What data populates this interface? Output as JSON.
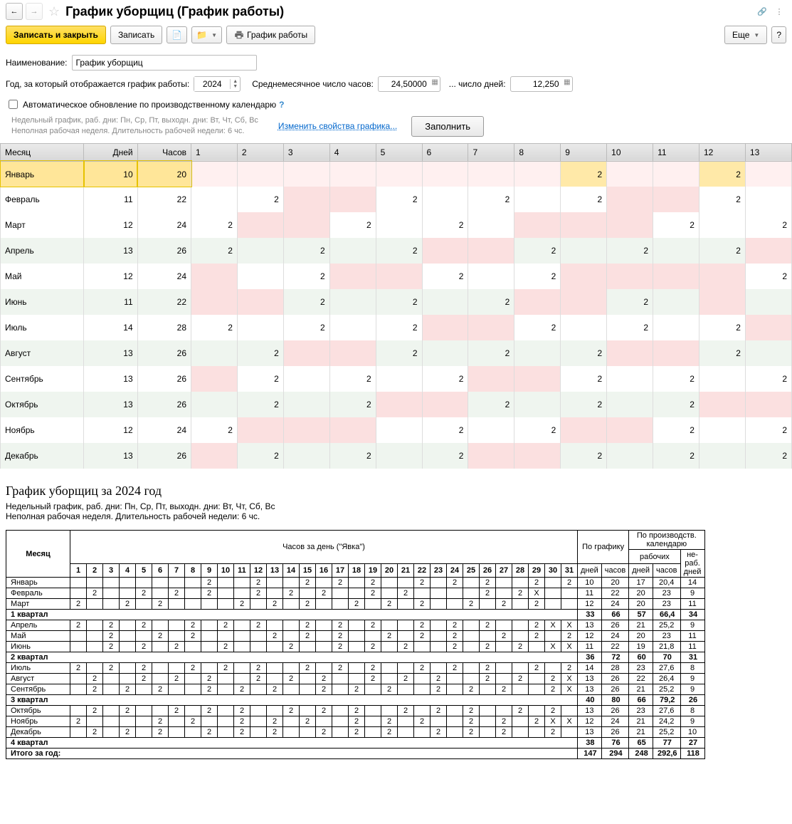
{
  "header": {
    "title": "График уборщиц (График работы)"
  },
  "toolbar": {
    "save_close": "Записать и закрыть",
    "save": "Записать",
    "print_schedule": "График работы",
    "more": "Еще"
  },
  "form": {
    "name_label": "Наименование:",
    "name_value": "График уборщиц",
    "year_label": "Год, за который отображается график работы:",
    "year_value": "2024",
    "avg_hours_label": "Среднемесячное число часов:",
    "avg_hours_value": "24,50000",
    "avg_days_label": "... число дней:",
    "avg_days_value": "12,250",
    "auto_update_label": "Автоматическое обновление по производственному календарю",
    "hint_line1": "Недельный график, раб. дни: Пн, Ср, Пт, выходн. дни: Вт, Чт, Сб, Вс",
    "hint_line2": "Неполная рабочая неделя. Длительность рабочей недели: 6 чс.",
    "change_props_link": "Изменить свойства графика...",
    "fill_btn": "Заполнить"
  },
  "cal_headers": {
    "month": "Месяц",
    "days": "Дней",
    "hours": "Часов"
  },
  "cal_day_cols": [
    "1",
    "2",
    "3",
    "4",
    "5",
    "6",
    "7",
    "8",
    "9",
    "10",
    "11",
    "12",
    "13"
  ],
  "cal_rows": [
    {
      "month": "Январь",
      "days": "10",
      "hours": "20",
      "selected": true,
      "cells": [
        {},
        {},
        {},
        {},
        {},
        {},
        {},
        {},
        {
          "v": "2",
          "h": true
        },
        {},
        {},
        {
          "v": "2",
          "h": true
        },
        {}
      ]
    },
    {
      "month": "Февраль",
      "days": "11",
      "hours": "22",
      "cells": [
        {},
        {
          "v": "2"
        },
        {
          "w": true
        },
        {
          "w": true
        },
        {
          "v": "2"
        },
        {},
        {
          "v": "2"
        },
        {},
        {
          "v": "2"
        },
        {
          "w": true
        },
        {
          "w": true
        },
        {
          "v": "2"
        },
        {}
      ]
    },
    {
      "month": "Март",
      "days": "12",
      "hours": "24",
      "cells": [
        {
          "v": "2"
        },
        {
          "w": true
        },
        {
          "w": true
        },
        {
          "v": "2"
        },
        {},
        {
          "v": "2"
        },
        {},
        {
          "w": true
        },
        {
          "w": true
        },
        {
          "w": true
        },
        {
          "v": "2"
        },
        {},
        {
          "v": "2"
        }
      ]
    },
    {
      "month": "Апрель",
      "days": "13",
      "hours": "26",
      "even": true,
      "cells": [
        {
          "v": "2"
        },
        {},
        {
          "v": "2"
        },
        {},
        {
          "v": "2"
        },
        {
          "w": true
        },
        {
          "w": true
        },
        {
          "v": "2"
        },
        {},
        {
          "v": "2"
        },
        {},
        {
          "v": "2"
        },
        {
          "w": true
        }
      ]
    },
    {
      "month": "Май",
      "days": "12",
      "hours": "24",
      "cells": [
        {
          "w": true
        },
        {},
        {
          "v": "2"
        },
        {
          "w": true
        },
        {
          "w": true
        },
        {
          "v": "2"
        },
        {},
        {
          "v": "2"
        },
        {
          "w": true
        },
        {
          "w": true
        },
        {
          "w": true
        },
        {
          "w": true
        },
        {
          "v": "2"
        }
      ]
    },
    {
      "month": "Июнь",
      "days": "11",
      "hours": "22",
      "even": true,
      "cells": [
        {
          "w": true
        },
        {
          "w": true
        },
        {
          "v": "2"
        },
        {},
        {
          "v": "2"
        },
        {},
        {
          "v": "2"
        },
        {
          "w": true
        },
        {
          "w": true
        },
        {
          "v": "2"
        },
        {},
        {
          "w": true
        },
        {}
      ]
    },
    {
      "month": "Июль",
      "days": "14",
      "hours": "28",
      "cells": [
        {
          "v": "2"
        },
        {},
        {
          "v": "2"
        },
        {},
        {
          "v": "2"
        },
        {
          "w": true
        },
        {
          "w": true
        },
        {
          "v": "2"
        },
        {},
        {
          "v": "2"
        },
        {},
        {
          "v": "2"
        },
        {
          "w": true
        }
      ]
    },
    {
      "month": "Август",
      "days": "13",
      "hours": "26",
      "even": true,
      "cells": [
        {},
        {
          "v": "2"
        },
        {
          "w": true
        },
        {
          "w": true
        },
        {
          "v": "2"
        },
        {},
        {
          "v": "2"
        },
        {},
        {
          "v": "2"
        },
        {
          "w": true
        },
        {
          "w": true
        },
        {
          "v": "2"
        },
        {}
      ]
    },
    {
      "month": "Сентябрь",
      "days": "13",
      "hours": "26",
      "cells": [
        {
          "w": true
        },
        {
          "v": "2"
        },
        {},
        {
          "v": "2"
        },
        {},
        {
          "v": "2"
        },
        {
          "w": true
        },
        {
          "w": true
        },
        {
          "v": "2"
        },
        {},
        {
          "v": "2"
        },
        {},
        {
          "v": "2"
        }
      ]
    },
    {
      "month": "Октябрь",
      "days": "13",
      "hours": "26",
      "even": true,
      "cells": [
        {},
        {
          "v": "2"
        },
        {},
        {
          "v": "2"
        },
        {
          "w": true
        },
        {
          "w": true
        },
        {
          "v": "2"
        },
        {},
        {
          "v": "2"
        },
        {},
        {
          "v": "2"
        },
        {
          "w": true
        },
        {
          "w": true
        }
      ]
    },
    {
      "month": "Ноябрь",
      "days": "12",
      "hours": "24",
      "cells": [
        {
          "v": "2"
        },
        {
          "w": true
        },
        {
          "w": true
        },
        {
          "w": true
        },
        {},
        {
          "v": "2"
        },
        {},
        {
          "v": "2"
        },
        {
          "w": true
        },
        {
          "w": true
        },
        {
          "v": "2"
        },
        {},
        {
          "v": "2"
        }
      ]
    },
    {
      "month": "Декабрь",
      "days": "13",
      "hours": "26",
      "even": true,
      "cells": [
        {
          "w": true
        },
        {
          "v": "2"
        },
        {},
        {
          "v": "2"
        },
        {},
        {
          "v": "2"
        },
        {
          "w": true
        },
        {
          "w": true
        },
        {
          "v": "2"
        },
        {},
        {
          "v": "2"
        },
        {},
        {
          "v": "2"
        }
      ]
    }
  ],
  "report": {
    "title": "График уборщиц за 2024 год",
    "desc_line1": "Недельный график, раб. дни: Пн, Ср, Пт, выходн. дни: Вт, Чт, Сб, Вс",
    "desc_line2": "Неполная рабочая неделя. Длительность рабочей недели: 6 чс.",
    "headers": {
      "month": "Месяц",
      "hours_per_day": "Часов за день (\"Явка\")",
      "by_schedule": "По графику",
      "by_calendar": "По производств. календарю",
      "days": "дней",
      "hours": "часов",
      "work": "рабочих",
      "nonwork": "не- раб. дней"
    },
    "day_cols": [
      "1",
      "2",
      "3",
      "4",
      "5",
      "6",
      "7",
      "8",
      "9",
      "10",
      "11",
      "12",
      "13",
      "14",
      "15",
      "16",
      "17",
      "18",
      "19",
      "20",
      "21",
      "22",
      "23",
      "24",
      "25",
      "26",
      "27",
      "28",
      "29",
      "30",
      "31"
    ],
    "rows": [
      {
        "type": "m",
        "month": "Январь",
        "days": [
          "",
          "",
          "",
          "",
          "",
          "",
          "",
          "",
          "2",
          "",
          "",
          "2",
          "",
          "",
          "2",
          "",
          "2",
          "",
          "2",
          "",
          "",
          "2",
          "",
          "2",
          "",
          "2",
          "",
          "",
          "2",
          "",
          "2"
        ],
        "g_d": "10",
        "g_h": "20",
        "c_d": "17",
        "c_h": "20,4",
        "n": "14"
      },
      {
        "type": "m",
        "month": "Февраль",
        "days": [
          "",
          "2",
          "",
          "",
          "2",
          "",
          "2",
          "",
          "2",
          "",
          "",
          "2",
          "",
          "2",
          "",
          "2",
          "",
          "",
          "2",
          "",
          "2",
          "",
          "",
          "",
          "",
          "2",
          "",
          "2",
          "X",
          "",
          ""
        ],
        "g_d": "11",
        "g_h": "22",
        "c_d": "20",
        "c_h": "23",
        "n": "9"
      },
      {
        "type": "m",
        "month": "Март",
        "days": [
          "2",
          "",
          "",
          "2",
          "",
          "2",
          "",
          "",
          "",
          "",
          "2",
          "",
          "2",
          "",
          "2",
          "",
          "",
          "2",
          "",
          "2",
          "",
          "2",
          "",
          "",
          "2",
          "",
          "2",
          "",
          "2",
          "",
          ""
        ],
        "g_d": "12",
        "g_h": "24",
        "c_d": "20",
        "c_h": "23",
        "n": "11"
      },
      {
        "type": "q",
        "label": "1 квартал",
        "g_d": "33",
        "g_h": "66",
        "c_d": "57",
        "c_h": "66,4",
        "n": "34"
      },
      {
        "type": "m",
        "month": "Апрель",
        "days": [
          "2",
          "",
          "2",
          "",
          "2",
          "",
          "",
          "2",
          "",
          "2",
          "",
          "2",
          "",
          "",
          "2",
          "",
          "2",
          "",
          "2",
          "",
          "",
          "2",
          "",
          "2",
          "",
          "2",
          "",
          "",
          "2",
          "X",
          "X"
        ],
        "g_d": "13",
        "g_h": "26",
        "c_d": "21",
        "c_h": "25,2",
        "n": "9"
      },
      {
        "type": "m",
        "month": "Май",
        "days": [
          "",
          "",
          "2",
          "",
          "",
          "2",
          "",
          "2",
          "",
          "",
          "",
          "",
          "2",
          "",
          "2",
          "",
          "2",
          "",
          "",
          "2",
          "",
          "2",
          "",
          "2",
          "",
          "",
          "2",
          "",
          "2",
          "",
          "2"
        ],
        "g_d": "12",
        "g_h": "24",
        "c_d": "20",
        "c_h": "23",
        "n": "11"
      },
      {
        "type": "m",
        "month": "Июнь",
        "days": [
          "",
          "",
          "2",
          "",
          "2",
          "",
          "2",
          "",
          "",
          "2",
          "",
          "",
          "",
          "2",
          "",
          "",
          "2",
          "",
          "2",
          "",
          "2",
          "",
          "",
          "2",
          "",
          "2",
          "",
          "2",
          "",
          "X",
          "X"
        ],
        "g_d": "11",
        "g_h": "22",
        "c_d": "19",
        "c_h": "21,8",
        "n": "11"
      },
      {
        "type": "q",
        "label": "2 квартал",
        "g_d": "36",
        "g_h": "72",
        "c_d": "60",
        "c_h": "70",
        "n": "31"
      },
      {
        "type": "m",
        "month": "Июль",
        "days": [
          "2",
          "",
          "2",
          "",
          "2",
          "",
          "",
          "2",
          "",
          "2",
          "",
          "2",
          "",
          "",
          "2",
          "",
          "2",
          "",
          "2",
          "",
          "",
          "2",
          "",
          "2",
          "",
          "2",
          "",
          "",
          "2",
          "",
          "2"
        ],
        "g_d": "14",
        "g_h": "28",
        "c_d": "23",
        "c_h": "27,6",
        "n": "8"
      },
      {
        "type": "m",
        "month": "Август",
        "days": [
          "",
          "2",
          "",
          "",
          "2",
          "",
          "2",
          "",
          "2",
          "",
          "",
          "2",
          "",
          "2",
          "",
          "2",
          "",
          "",
          "2",
          "",
          "2",
          "",
          "2",
          "",
          "",
          "2",
          "",
          "2",
          "",
          "2",
          "X"
        ],
        "g_d": "13",
        "g_h": "26",
        "c_d": "22",
        "c_h": "26,4",
        "n": "9"
      },
      {
        "type": "m",
        "month": "Сентябрь",
        "days": [
          "",
          "2",
          "",
          "2",
          "",
          "2",
          "",
          "",
          "2",
          "",
          "2",
          "",
          "2",
          "",
          "",
          "2",
          "",
          "2",
          "",
          "2",
          "",
          "",
          "2",
          "",
          "2",
          "",
          "2",
          "",
          "",
          "2",
          "X"
        ],
        "g_d": "13",
        "g_h": "26",
        "c_d": "21",
        "c_h": "25,2",
        "n": "9"
      },
      {
        "type": "q",
        "label": "3 квартал",
        "g_d": "40",
        "g_h": "80",
        "c_d": "66",
        "c_h": "79,2",
        "n": "26"
      },
      {
        "type": "m",
        "month": "Октябрь",
        "days": [
          "",
          "2",
          "",
          "2",
          "",
          "",
          "2",
          "",
          "2",
          "",
          "2",
          "",
          "",
          "2",
          "",
          "2",
          "",
          "2",
          "",
          "",
          "2",
          "",
          "2",
          "",
          "2",
          "",
          "",
          "2",
          "",
          "2",
          ""
        ],
        "g_d": "13",
        "g_h": "26",
        "c_d": "23",
        "c_h": "27,6",
        "n": "8"
      },
      {
        "type": "m",
        "month": "Ноябрь",
        "days": [
          "2",
          "",
          "",
          "",
          "",
          "2",
          "",
          "2",
          "",
          "",
          "2",
          "",
          "2",
          "",
          "2",
          "",
          "",
          "2",
          "",
          "2",
          "",
          "2",
          "",
          "",
          "2",
          "",
          "2",
          "",
          "2",
          "X",
          "X"
        ],
        "g_d": "12",
        "g_h": "24",
        "c_d": "21",
        "c_h": "24,2",
        "n": "9"
      },
      {
        "type": "m",
        "month": "Декабрь",
        "days": [
          "",
          "2",
          "",
          "2",
          "",
          "2",
          "",
          "",
          "2",
          "",
          "2",
          "",
          "2",
          "",
          "",
          "2",
          "",
          "2",
          "",
          "2",
          "",
          "",
          "2",
          "",
          "2",
          "",
          "2",
          "",
          "",
          "2",
          ""
        ],
        "g_d": "13",
        "g_h": "26",
        "c_d": "21",
        "c_h": "25,2",
        "n": "10"
      },
      {
        "type": "q",
        "label": "4 квартал",
        "g_d": "38",
        "g_h": "76",
        "c_d": "65",
        "c_h": "77",
        "n": "27"
      },
      {
        "type": "t",
        "label": "Итого за год:",
        "g_d": "147",
        "g_h": "294",
        "c_d": "248",
        "c_h": "292,6",
        "n": "118"
      }
    ]
  }
}
